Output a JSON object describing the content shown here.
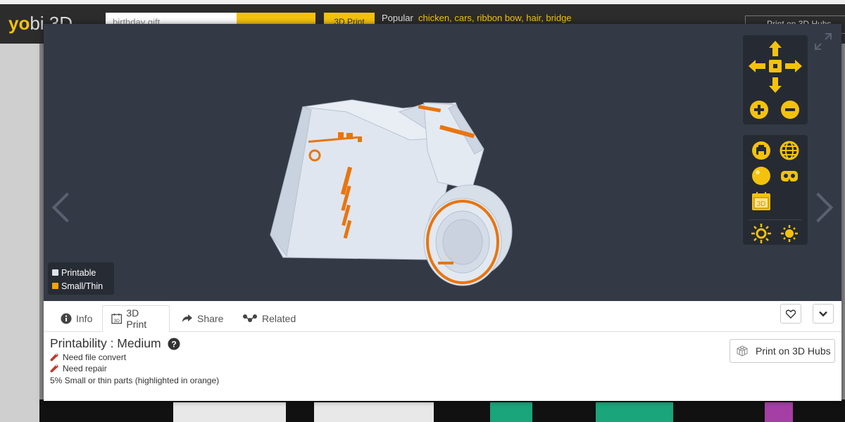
{
  "site_header": {
    "logo_main": "yo",
    "logo_rest": "bi 3D",
    "search_value": "birthday gift",
    "print_3d_button": "3D Print",
    "popular_label": "Popular",
    "popular_tags": "chicken, cars, ribbon bow, hair, bridge",
    "print_hubs_label": "Print on 3D Hubs"
  },
  "viewer": {
    "legend": {
      "printable_label": "Printable",
      "small_thin_label": "Small/Thin"
    }
  },
  "tabs": [
    {
      "label": "Info",
      "icon": "info-icon"
    },
    {
      "label": "3D Print",
      "icon": "3d-print-icon",
      "active": true
    },
    {
      "label": "Share",
      "icon": "share-arrow-icon"
    },
    {
      "label": "Related",
      "icon": "network-icon"
    }
  ],
  "details": {
    "printability": "Printability : Medium",
    "issues": [
      "Need file convert",
      "Need repair"
    ],
    "small_parts": "5% Small or thin parts (highlighted in orange)",
    "print_hubs_button": "Print on 3D Hubs"
  },
  "colors": {
    "accent": "#f4c20d",
    "viewer_bg": "#343a45",
    "printable": "#dfe6ef",
    "small_thin": "#e8750f"
  }
}
